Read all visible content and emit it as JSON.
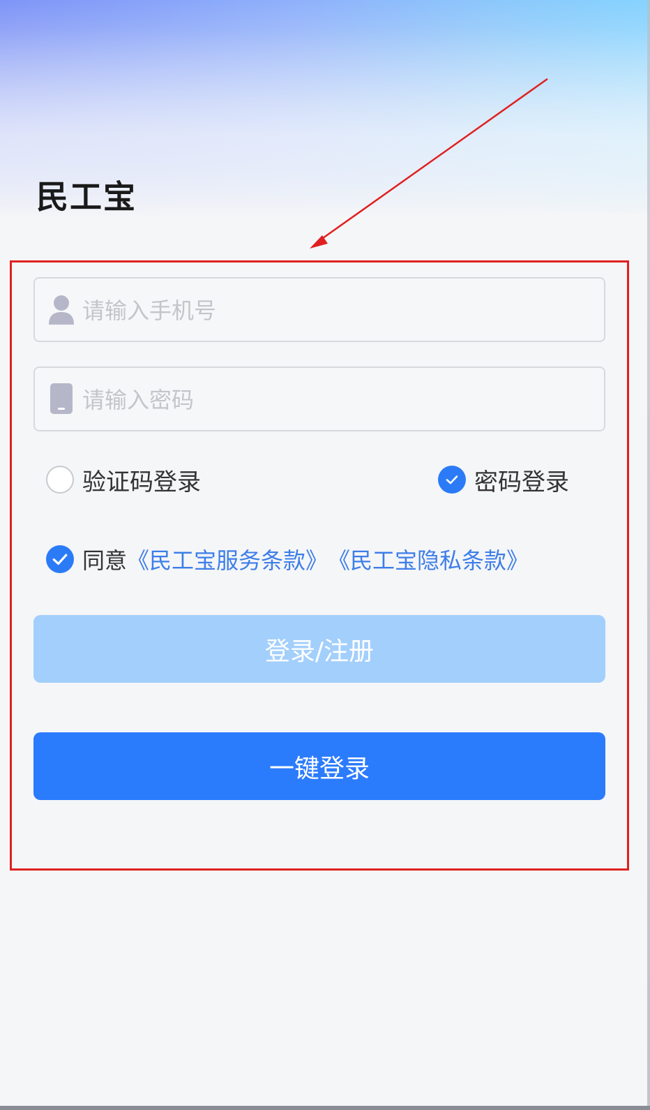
{
  "app": {
    "title": "民工宝"
  },
  "form": {
    "phone_placeholder": "请输入手机号",
    "password_placeholder": "请输入密码",
    "phone_icon": "user-icon",
    "password_icon": "phone-device-icon"
  },
  "login_mode": {
    "options": [
      {
        "label": "验证码登录",
        "selected": false
      },
      {
        "label": "密码登录",
        "selected": true
      }
    ]
  },
  "agreement": {
    "checked": true,
    "prefix": "同意",
    "service_terms": "《民工宝服务条款》",
    "privacy_terms": "《民工宝隐私条款》"
  },
  "buttons": {
    "register_label": "登录/注册",
    "onekey_label": "一键登录"
  },
  "colors": {
    "accent": "#2b7bfd",
    "accent_disabled": "#a3cffc",
    "link": "#3d7ee8",
    "annotation": "#e02020"
  }
}
